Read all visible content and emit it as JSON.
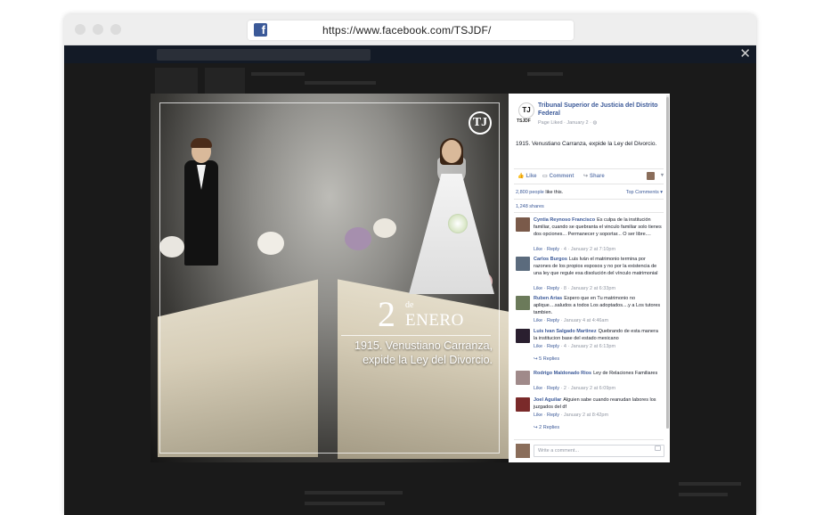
{
  "browser": {
    "url": "https://www.facebook.com/TSJDF/",
    "favicon_letter": "f"
  },
  "photo": {
    "logo_letter": "TJ",
    "date_day": "2",
    "date_de": "de",
    "date_month": "ENERO",
    "caption_line1": "1915. Venustiano Carranza,",
    "caption_line2": "expide la Ley del Divorcio."
  },
  "post": {
    "page_logo": "TJ",
    "page_abbr": "TSJDF",
    "page_name": "Tribunal Superior de Justicia del Distrito Federal",
    "page_meta": "Page Liked · January 2 · ",
    "text": "1915. Venustiano Carranza, expide la Ley del Divorcio.",
    "actions": {
      "like": "Like",
      "comment": "Comment",
      "share": "Share"
    },
    "likes_count": "2,800 people",
    "likes_suffix": " like this.",
    "top_comments": "Top Comments ▾",
    "shares": "1,248 shares",
    "comments": [
      {
        "name": "Cyntia Reynoso Francisco",
        "text": "Es culpa de la institución familiar, cuando se quebranta el vinculo familiar solo tienes dos opciones... Permanecer y soportar... O ser libre....",
        "meta_like": "Like",
        "meta_reply": "Reply",
        "meta_rest": " · 4 · January 2 at 7:10pm",
        "avatar_color": "#7a5a4a"
      },
      {
        "name": "Carlos Burgos",
        "text": "Luis Iván el matrimonio termina por razones de los propios esposos y no por la existencia de una ley que regule esa disolución del vínculo matrimonial",
        "meta_like": "Like",
        "meta_reply": "Reply",
        "meta_rest": " · 8 · January 2 at 6:33pm",
        "avatar_color": "#5b6b7d"
      },
      {
        "name": "Ruben Arias",
        "text": "Espero que en Tu matrimonio no aplique....saludos a todos Los adoptados....y a Los tutores tambien.",
        "meta_like": "Like",
        "meta_reply": "Reply",
        "meta_rest": " · January 4 at 4:46am",
        "avatar_color": "#6b7a5a"
      },
      {
        "name": "Luis Ivan Salgado Martinez",
        "text": "Quebrando de esta manera la institucion base del estado mexicano",
        "meta_like": "Like",
        "meta_reply": "Reply",
        "meta_rest": " · 4 · January 2 at 6:13pm",
        "replies": "5 Replies",
        "avatar_color": "#2a1f2f"
      },
      {
        "name": "Rodrigo Maldonado Rios",
        "text": "Ley de Relaciones Familiares",
        "meta_like": "Like",
        "meta_reply": "Reply",
        "meta_rest": " · 2 · January 2 at 6:09pm",
        "avatar_color": "#a08a8a"
      },
      {
        "name": "Joel Aguilar",
        "text": "Alguien sabe cuando reanudan labores los juzgados del df",
        "meta_like": "Like",
        "meta_reply": "Reply",
        "meta_rest": " · January 2 at 8:42pm",
        "replies": "2 Replies",
        "avatar_color": "#7a2a2a"
      }
    ],
    "write_placeholder": "Write a comment..."
  },
  "colors": {
    "facebook_blue": "#3b5998",
    "link_blue": "#3b5998",
    "meta_gray": "#9197a3",
    "overlay_dark": "#1a1a1a"
  }
}
